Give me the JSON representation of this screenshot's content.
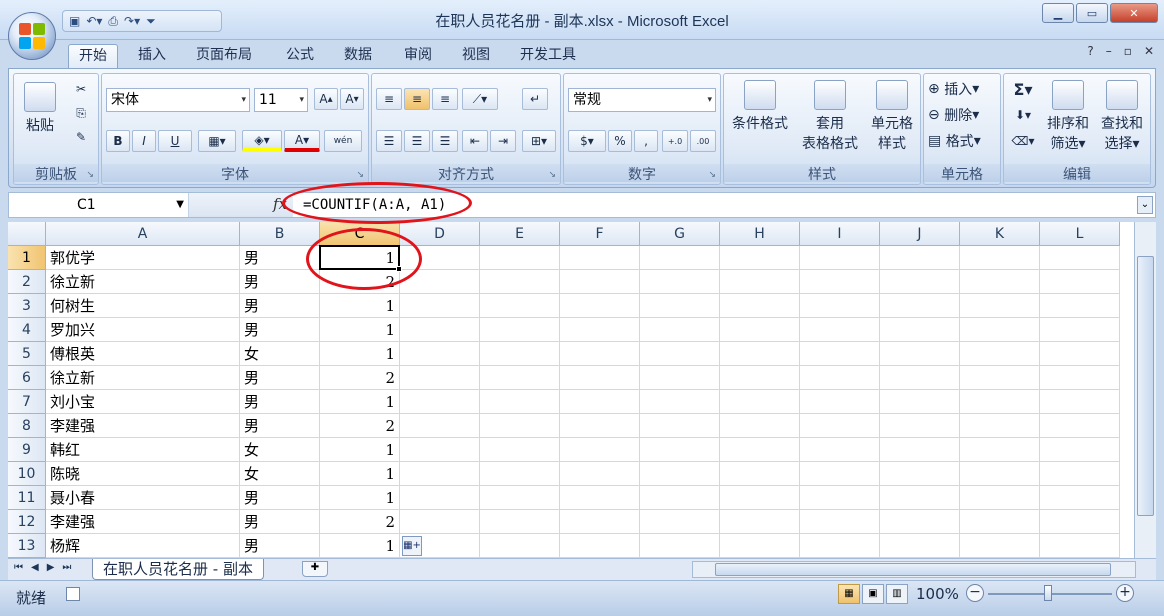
{
  "window": {
    "title": "在职人员花名册 - 副本.xlsx - Microsoft Excel"
  },
  "ribbon_tabs": [
    "开始",
    "插入",
    "页面布局",
    "公式",
    "数据",
    "审阅",
    "视图",
    "开发工具"
  ],
  "ribbon": {
    "clipboard": {
      "paste": "粘贴",
      "label": "剪贴板"
    },
    "font": {
      "name": "宋体",
      "size": "11",
      "bold": "B",
      "italic": "I",
      "underline": "U",
      "font_color": "A",
      "phonetic": "wén",
      "label": "字体"
    },
    "alignment": {
      "label": "对齐方式"
    },
    "number": {
      "format": "常规",
      "percent": "%",
      "comma": ",",
      "label": "数字"
    },
    "styles": {
      "cond_format": "条件格式",
      "table_format_1": "套用",
      "table_format_2": "表格格式",
      "cell_style_1": "单元格",
      "cell_style_2": "样式",
      "label": "样式"
    },
    "cells": {
      "insert": "插入",
      "delete": "删除",
      "format": "格式",
      "label": "单元格"
    },
    "editing": {
      "sum": "Σ",
      "sort_1": "排序和",
      "sort_2": "筛选",
      "find_1": "查找和",
      "find_2": "选择",
      "label": "编辑"
    }
  },
  "formula_bar": {
    "name_box": "C1",
    "fx": "fx",
    "formula": "=COUNTIF(A:A, A1)"
  },
  "columns": [
    "A",
    "B",
    "C",
    "D",
    "E",
    "F",
    "G",
    "H",
    "I",
    "J",
    "K",
    "L"
  ],
  "rows": [
    {
      "n": "1",
      "a": "郭优学",
      "b": "男",
      "c": "1"
    },
    {
      "n": "2",
      "a": "徐立新",
      "b": "男",
      "c": "2"
    },
    {
      "n": "3",
      "a": "何树生",
      "b": "男",
      "c": "1"
    },
    {
      "n": "4",
      "a": "罗加兴",
      "b": "男",
      "c": "1"
    },
    {
      "n": "5",
      "a": "傅根英",
      "b": "女",
      "c": "1"
    },
    {
      "n": "6",
      "a": "徐立新",
      "b": "男",
      "c": "2"
    },
    {
      "n": "7",
      "a": "刘小宝",
      "b": "男",
      "c": "1"
    },
    {
      "n": "8",
      "a": "李建强",
      "b": "男",
      "c": "2"
    },
    {
      "n": "9",
      "a": "韩红",
      "b": "女",
      "c": "1"
    },
    {
      "n": "10",
      "a": "陈晓",
      "b": "女",
      "c": "1"
    },
    {
      "n": "11",
      "a": "聂小春",
      "b": "男",
      "c": "1"
    },
    {
      "n": "12",
      "a": "李建强",
      "b": "男",
      "c": "2"
    },
    {
      "n": "13",
      "a": "杨辉",
      "b": "男",
      "c": "1"
    }
  ],
  "sheet_tab": "在职人员花名册 - 副本",
  "status": {
    "ready": "就绪",
    "zoom": "100%"
  },
  "colors": {
    "annotation": "#e0141a",
    "selection": "#f1c470"
  }
}
